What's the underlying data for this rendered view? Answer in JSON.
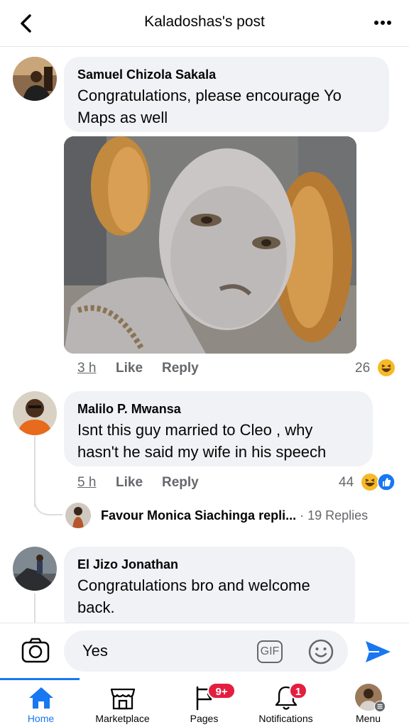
{
  "header": {
    "title": "Kaladoshas's post"
  },
  "comments": [
    {
      "author": "Samuel Chizola Sakala",
      "text_line1": "Congratulations, please encourage Yo",
      "text_line2": "Maps as well",
      "time": "3 h",
      "like": "Like",
      "reply": "Reply",
      "reactions": "26"
    },
    {
      "author": "Malilo P. Mwansa",
      "text_line1": "Isnt this guy married to Cleo  , why",
      "text_line2": "hasn't he said my wife in his speech",
      "time": "5 h",
      "like": "Like",
      "reply": "Reply",
      "reactions": "44",
      "reply_preview": {
        "author": "Favour Monica Siachinga",
        "suffix": "repli...",
        "count": "· 19 Replies"
      }
    },
    {
      "author": "El Jizo Jonathan",
      "text_line1": "Congratulations bro and welcome",
      "text_line2": "back."
    }
  ],
  "composer": {
    "value": "Yes",
    "gif_label": "GIF"
  },
  "tabs": [
    {
      "label": "Home",
      "icon": "home-icon",
      "active": true
    },
    {
      "label": "Marketplace",
      "icon": "marketplace-icon"
    },
    {
      "label": "Pages",
      "icon": "pages-icon",
      "badge": "9+"
    },
    {
      "label": "Notifications",
      "icon": "bell-icon",
      "badge": "1"
    },
    {
      "label": "Menu",
      "icon": "menu-avatar"
    }
  ],
  "colors": {
    "accent": "#1877f2",
    "badge": "#e41e3f",
    "bubble": "#f0f2f5",
    "muted": "#65676b"
  }
}
